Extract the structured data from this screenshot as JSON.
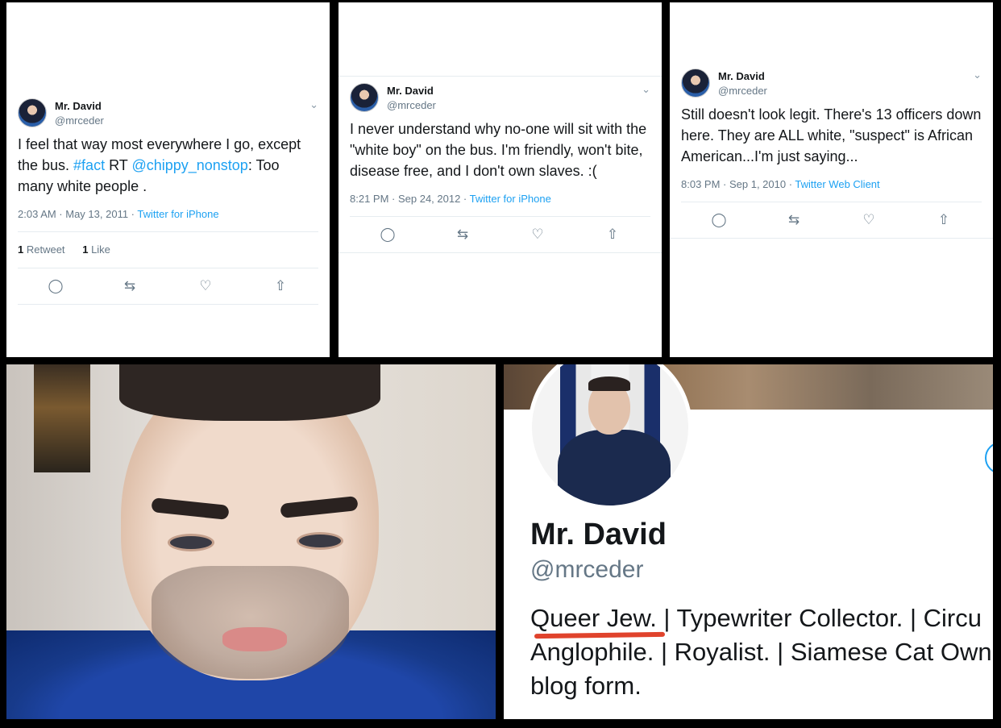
{
  "tweet1": {
    "name": "Mr. David",
    "handle": "@mrceder",
    "text_a": "I feel that way most everywhere I go, except the bus. ",
    "hashtag": "#fact",
    "text_b": " RT ",
    "mention": "@chippy_nonstop",
    "text_c": ": Too many white people .",
    "timestamp": "2:03 AM · May 13, 2011 · ",
    "source": "Twitter for iPhone",
    "retweets": "1",
    "retweets_label": " Retweet",
    "likes": "1",
    "likes_label": " Like"
  },
  "tweet2": {
    "name": "Mr. David",
    "handle": "@mrceder",
    "text": "I never understand why no-one will sit with the \"white boy\" on the bus. I'm friendly, won't bite, disease free, and I don't own slaves. :(",
    "timestamp": "8:21 PM · Sep 24, 2012 · ",
    "source": "Twitter for iPhone"
  },
  "tweet3": {
    "name": "Mr. David",
    "handle": "@mrceder",
    "text": "Still doesn't look legit. There's 13 officers down here. They are ALL white, \"suspect\" is African American...I'm just saying...",
    "timestamp": "8:03 PM · Sep 1, 2010 · ",
    "source": "Twitter Web Client"
  },
  "profile": {
    "name": "Mr. David",
    "handle": "@mrceder",
    "bio_line1": "Queer Jew. | Typewriter Collector. | Circu",
    "bio_line2": "Anglophile. | Royalist. | Siamese Cat Own",
    "bio_line3": "blog form."
  },
  "icons": {
    "reply": "reply-icon",
    "retweet": "retweet-icon",
    "like": "like-icon",
    "share": "share-icon",
    "chevron": "chevron-down-icon"
  },
  "colors": {
    "link": "#1da1f2",
    "muted": "#657786",
    "text": "#14171a",
    "highlight": "#e0432c"
  }
}
